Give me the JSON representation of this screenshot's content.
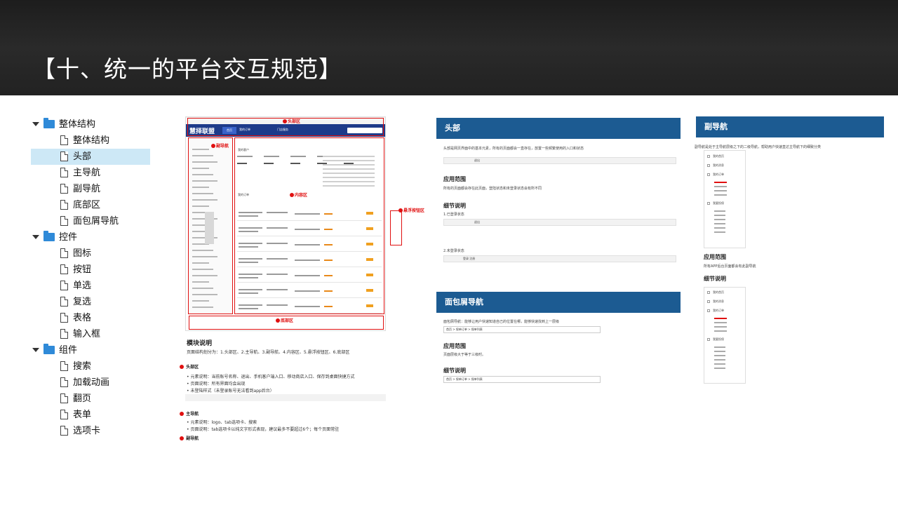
{
  "banner": {
    "title": "【十、统一的平台交互规范】"
  },
  "tree": [
    {
      "level": 0,
      "label": "整体结构",
      "folder": true,
      "selected": false
    },
    {
      "level": 1,
      "label": "整体结构",
      "folder": false,
      "selected": false
    },
    {
      "level": 1,
      "label": "头部",
      "folder": false,
      "selected": true
    },
    {
      "level": 1,
      "label": "主导航",
      "folder": false,
      "selected": false
    },
    {
      "level": 1,
      "label": "副导航",
      "folder": false,
      "selected": false
    },
    {
      "level": 1,
      "label": "底部区",
      "folder": false,
      "selected": false
    },
    {
      "level": 1,
      "label": "面包屑导航",
      "folder": false,
      "selected": false
    },
    {
      "level": 0,
      "label": "控件",
      "folder": true,
      "selected": false
    },
    {
      "level": 1,
      "label": "图标",
      "folder": false,
      "selected": false
    },
    {
      "level": 1,
      "label": "按钮",
      "folder": false,
      "selected": false
    },
    {
      "level": 1,
      "label": "单选",
      "folder": false,
      "selected": false
    },
    {
      "level": 1,
      "label": "复选",
      "folder": false,
      "selected": false
    },
    {
      "level": 1,
      "label": "表格",
      "folder": false,
      "selected": false
    },
    {
      "level": 1,
      "label": "输入框",
      "folder": false,
      "selected": false
    },
    {
      "level": 0,
      "label": "组件",
      "folder": true,
      "selected": false
    },
    {
      "level": 1,
      "label": "搜索",
      "folder": false,
      "selected": false
    },
    {
      "level": 1,
      "label": "加载动画",
      "folder": false,
      "selected": false
    },
    {
      "level": 1,
      "label": "翻页",
      "folder": false,
      "selected": false
    },
    {
      "level": 1,
      "label": "表单",
      "folder": false,
      "selected": false
    },
    {
      "level": 1,
      "label": "选项卡",
      "folder": false,
      "selected": false
    }
  ],
  "mock": {
    "logo": "慧择联盟",
    "nav": [
      "首页",
      "我的订单",
      "门店服务"
    ],
    "labels": {
      "header": "头部区",
      "subnav": "副导航",
      "content": "内容区",
      "float": "悬浮按钮区",
      "footer": "底部区"
    },
    "section_titles": [
      "我的客户",
      "我的订单"
    ]
  },
  "module": {
    "title": "模块说明",
    "intro": "页面结构划分为：1.头部区、2.主导航、3.副导航、4.内容区、5.悬浮按钮区、6.底部区",
    "s1_title": "头部区",
    "s1_lines": [
      "• 元素说明：当前账号名称、退出、手机客户端入口、移动商店入口、保存到桌面快捷方式",
      "• 页面说明：所有界面均会出现",
      "• 未登陆样式（未登录账号无法看到app后台）"
    ],
    "s2_title": "主导航",
    "s2_lines": [
      "• 元素说明：logo、tab选项卡、搜索",
      "• 页面说明：tab选项卡以纯文字形式表现，建议最多不要超过6个；每个页面常驻"
    ],
    "s3_title": "副导航"
  },
  "head_panel": {
    "title": "头部",
    "desc": "头部是网页界面中的基本元素，所有的页面都会一直存在，放置一些频繁使用的入口和状态",
    "scope_title": "应用范围",
    "scope_text": "所有的页面都会存在此页面，登陆状态和未登录状态会有所不同",
    "detail_title": "细节说明",
    "logged_in": "1.已登录状态",
    "logged_out": "2.未登录状态",
    "bar_text": "退出",
    "bar_text2": "登录    注册"
  },
  "sub_panel": {
    "title": "副导航",
    "desc": "副导航是处于主导航层级之下的二级导航，帮助用户快速直达主导航下的细致分类",
    "scope_title": "应用范围",
    "scope_text": "所有APP后台页面都会有此副导航",
    "detail_title": "细节说明",
    "items": [
      "我的首页",
      "我的消息",
      "我的订单",
      "我要投保"
    ]
  },
  "crumb_panel": {
    "title": "面包屑导航",
    "desc": "面包屑导航：能够让用户快速知道自己的位置在哪，能够快速找到上一层级",
    "scope_title": "应用范围",
    "scope_text": "页面层级大于等于三级时。",
    "detail_title": "细节说明",
    "crumb1": "首页 > 保单订单 > 保单列表",
    "crumb2": "首页 > 保单订单 > 保单列表"
  }
}
